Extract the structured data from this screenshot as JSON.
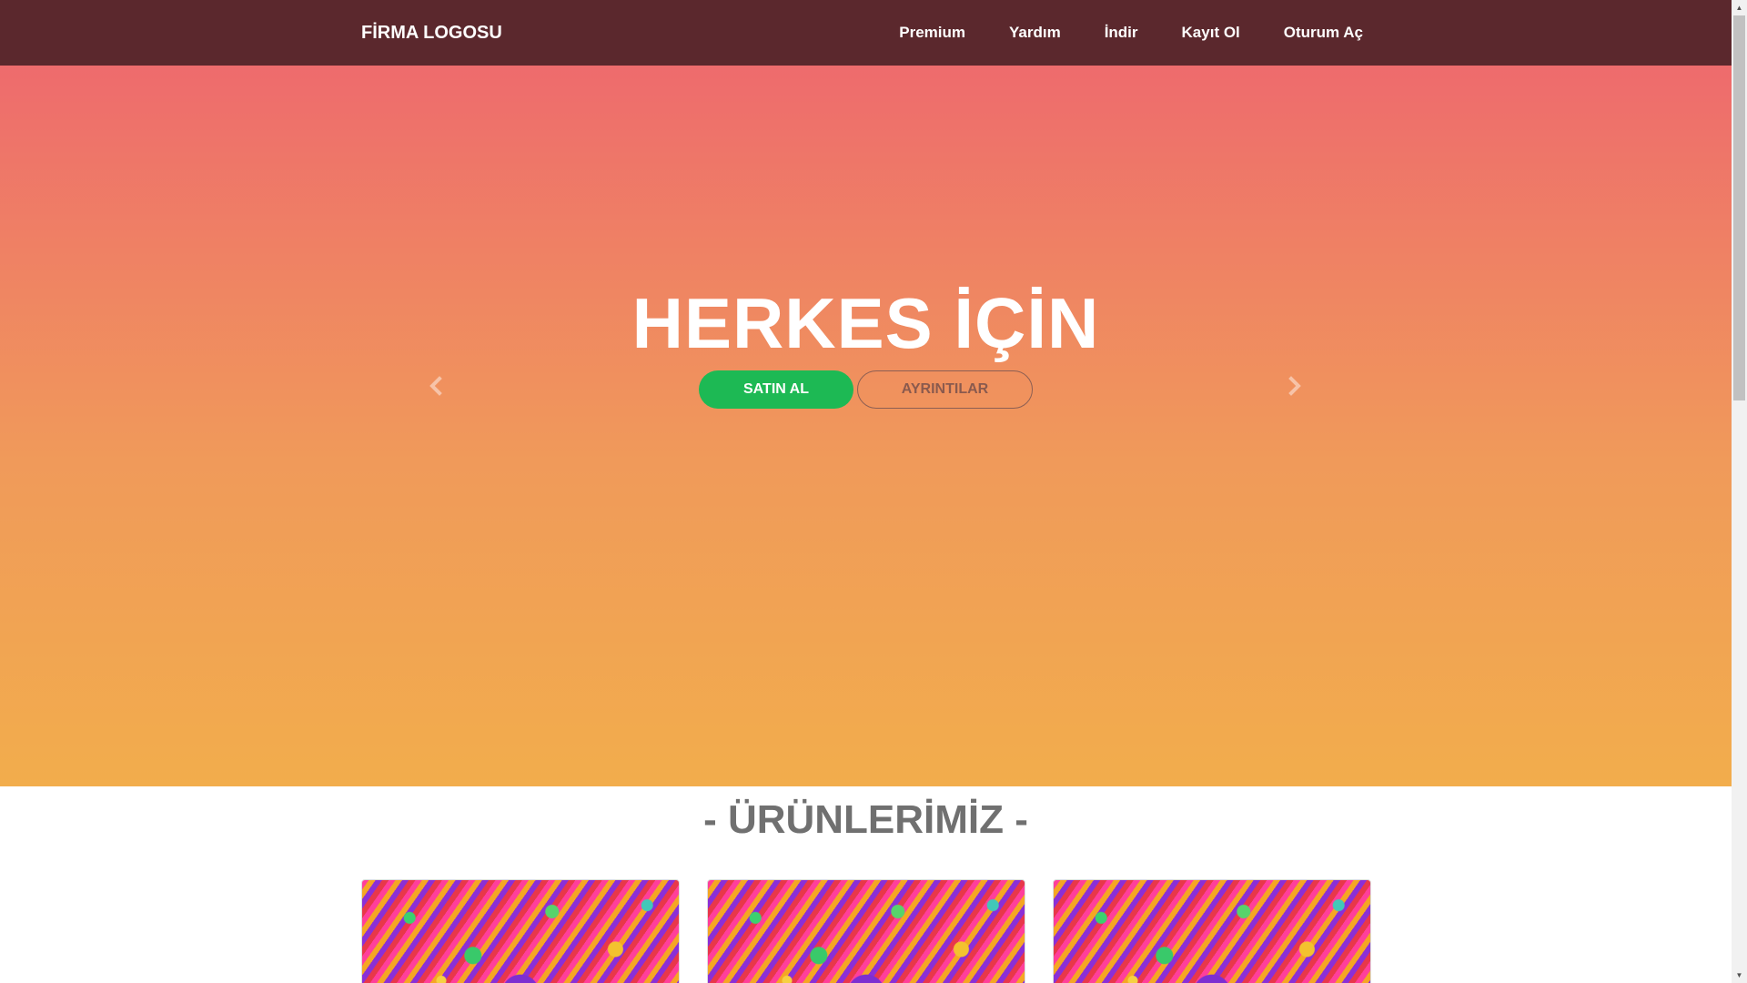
{
  "nav": {
    "logo": "FİRMA LOGOSU",
    "links": [
      "Premium",
      "Yardım",
      "İndir",
      "Kayıt Ol",
      "Oturum Aç"
    ]
  },
  "hero": {
    "title": "HERKES İÇİN",
    "buy_button": "SATIN AL",
    "details_button": "AYRINTILAR",
    "icons": [
      "chevron-left-icon",
      "chevron-right-icon"
    ]
  },
  "products": {
    "title": "- ÜRÜNLERİMİZ -",
    "items": [
      {
        "image": "psychedelic-eye-artwork"
      },
      {
        "image": "psychedelic-eye-artwork"
      },
      {
        "image": "psychedelic-eye-artwork"
      }
    ]
  },
  "colors": {
    "navbar": "#5b282d",
    "hero_top": "#ee6b6d",
    "hero_bottom": "#f2ad4c",
    "buy_button": "#1db954",
    "section_title": "#707070"
  }
}
